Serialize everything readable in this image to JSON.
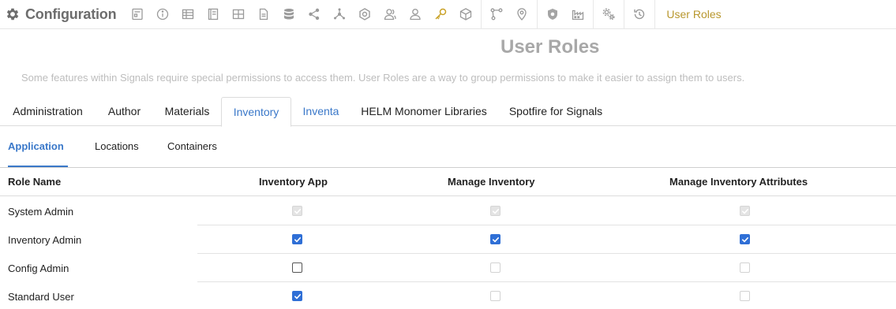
{
  "app": {
    "title": "Configuration",
    "breadcrumb": "User Roles"
  },
  "toolbar_icons": [
    "form-icon",
    "info-icon",
    "table-icon",
    "notebook-icon",
    "grid-icon",
    "document-icon",
    "database-icon",
    "share-icon",
    "network-icon",
    "badge-icon",
    "users-icon",
    "user-icon",
    "key-icon",
    "cube-icon",
    "workflow-icon",
    "location-icon",
    "shield-icon",
    "factory-icon",
    "settings-gears-icon",
    "history-icon"
  ],
  "header": {
    "title": "User Roles",
    "description": "Some features within Signals require special permissions to access them. User Roles are a way to group permissions to make it easier to assign them to users."
  },
  "tabs": [
    {
      "label": "Administration",
      "state": "normal"
    },
    {
      "label": "Author",
      "state": "normal"
    },
    {
      "label": "Materials",
      "state": "normal"
    },
    {
      "label": "Inventory",
      "state": "active"
    },
    {
      "label": "Inventa",
      "state": "link"
    },
    {
      "label": "HELM Monomer Libraries",
      "state": "normal"
    },
    {
      "label": "Spotfire for Signals",
      "state": "normal"
    }
  ],
  "subtabs": [
    {
      "label": "Application",
      "active": true
    },
    {
      "label": "Locations",
      "active": false
    },
    {
      "label": "Containers",
      "active": false
    }
  ],
  "table": {
    "columns": [
      "Role Name",
      "Inventory App",
      "Manage Inventory",
      "Manage Inventory Attributes"
    ],
    "rows": [
      {
        "name": "System Admin",
        "perms": [
          {
            "checked": true,
            "disabled": true
          },
          {
            "checked": true,
            "disabled": true
          },
          {
            "checked": true,
            "disabled": true
          }
        ]
      },
      {
        "name": "Inventory Admin",
        "perms": [
          {
            "checked": true,
            "disabled": false
          },
          {
            "checked": true,
            "disabled": false
          },
          {
            "checked": true,
            "disabled": false
          }
        ]
      },
      {
        "name": "Config Admin",
        "perms": [
          {
            "checked": false,
            "disabled": false
          },
          {
            "checked": false,
            "disabled": true
          },
          {
            "checked": false,
            "disabled": true
          }
        ]
      },
      {
        "name": "Standard User",
        "perms": [
          {
            "checked": true,
            "disabled": false
          },
          {
            "checked": false,
            "disabled": true
          },
          {
            "checked": false,
            "disabled": true
          }
        ]
      }
    ]
  },
  "colors": {
    "accent": "#3a78c9",
    "breadcrumb": "#b8972e",
    "checkbox": "#2f6fd6"
  }
}
